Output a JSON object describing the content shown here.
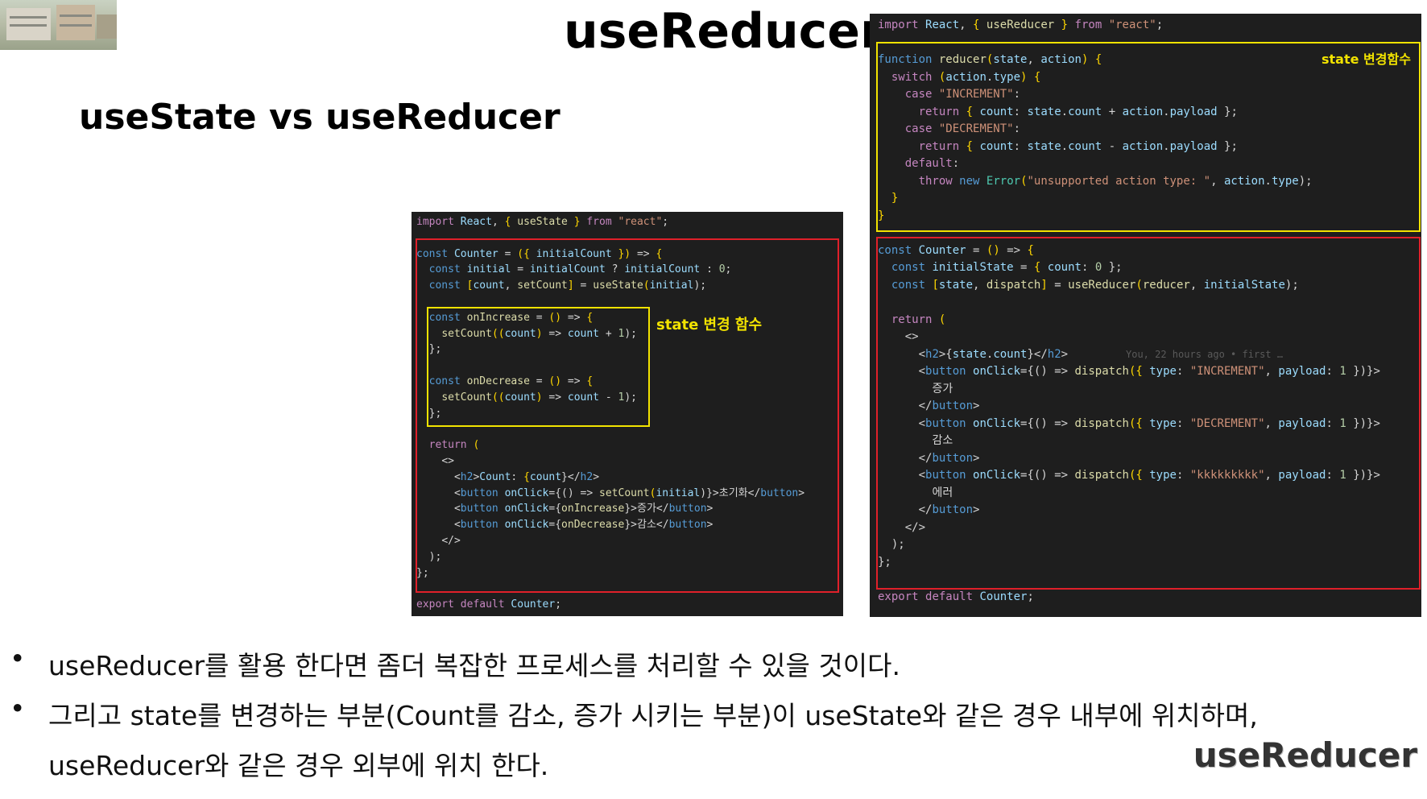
{
  "title": "useReducer",
  "subtitle": "useState vs useReducer",
  "left_code": {
    "lines": [
      "import React, { useState } from \"react\";",
      "",
      "const Counter = ({ initialCount }) => {",
      "  const initial = initialCount ? initialCount : 0;",
      "  const [count, setCount] = useState(initial);",
      "",
      "  const onIncrease = () => {",
      "    setCount((count) => count + 1);",
      "  };",
      "",
      "  const onDecrease = () => {",
      "    setCount((count) => count - 1);",
      "  };",
      "",
      "  return (",
      "    <>",
      "      <h2>Count: {count}</h2>",
      "      <button onClick={() => setCount(initial)}>초기화</button>",
      "      <button onClick={onIncrease}>증가</button>",
      "      <button onClick={onDecrease}>감소</button>",
      "    </>",
      "  );",
      "};",
      "",
      "export default Counter;"
    ],
    "annotation": "state 변경 함수"
  },
  "right_code": {
    "lines": [
      "import React, { useReducer } from \"react\";",
      "",
      "function reducer(state, action) {",
      "  switch (action.type) {",
      "    case \"INCREMENT\":",
      "      return { count: state.count + action.payload };",
      "    case \"DECREMENT\":",
      "      return { count: state.count - action.payload };",
      "    default:",
      "      throw new Error(\"unsupported action type: \", action.type);",
      "  }",
      "}",
      "",
      "const Counter = () => {",
      "  const initialState = { count: 0 };",
      "  const [state, dispatch] = useReducer(reducer, initialState);",
      "",
      "  return (",
      "    <>",
      "      <h2>{state.count}</h2>",
      "      <button onClick={() => dispatch({ type: \"INCREMENT\", payload: 1 })}>",
      "        증가",
      "      </button>",
      "      <button onClick={() => dispatch({ type: \"DECREMENT\", payload: 1 })}>",
      "        감소",
      "      </button>",
      "      <button onClick={() => dispatch({ type: \"kkkkkkkkk\", payload: 1 })}>",
      "        에러",
      "      </button>",
      "    </>",
      "  );",
      "};",
      "",
      "export default Counter;"
    ],
    "annotation": "state 변경함수",
    "git_blame": "You, 22 hours ago • first …"
  },
  "bullets": [
    "useReducer를 활용 한다면 좀더 복잡한 프로세스를 처리할 수 있을 것이다.",
    "그리고 state를 변경하는 부분(Count를 감소, 증가 시키는 부분)이 useState와 같은 경우 내부에 위치하며,",
    "useReducer와 같은 경우 외부에 위치 한다."
  ],
  "corner_logo": "useReducer",
  "colors": {
    "editor_bg": "#1e1e1e",
    "highlight_red": "#e0202a",
    "highlight_yellow": "#f2e300"
  }
}
